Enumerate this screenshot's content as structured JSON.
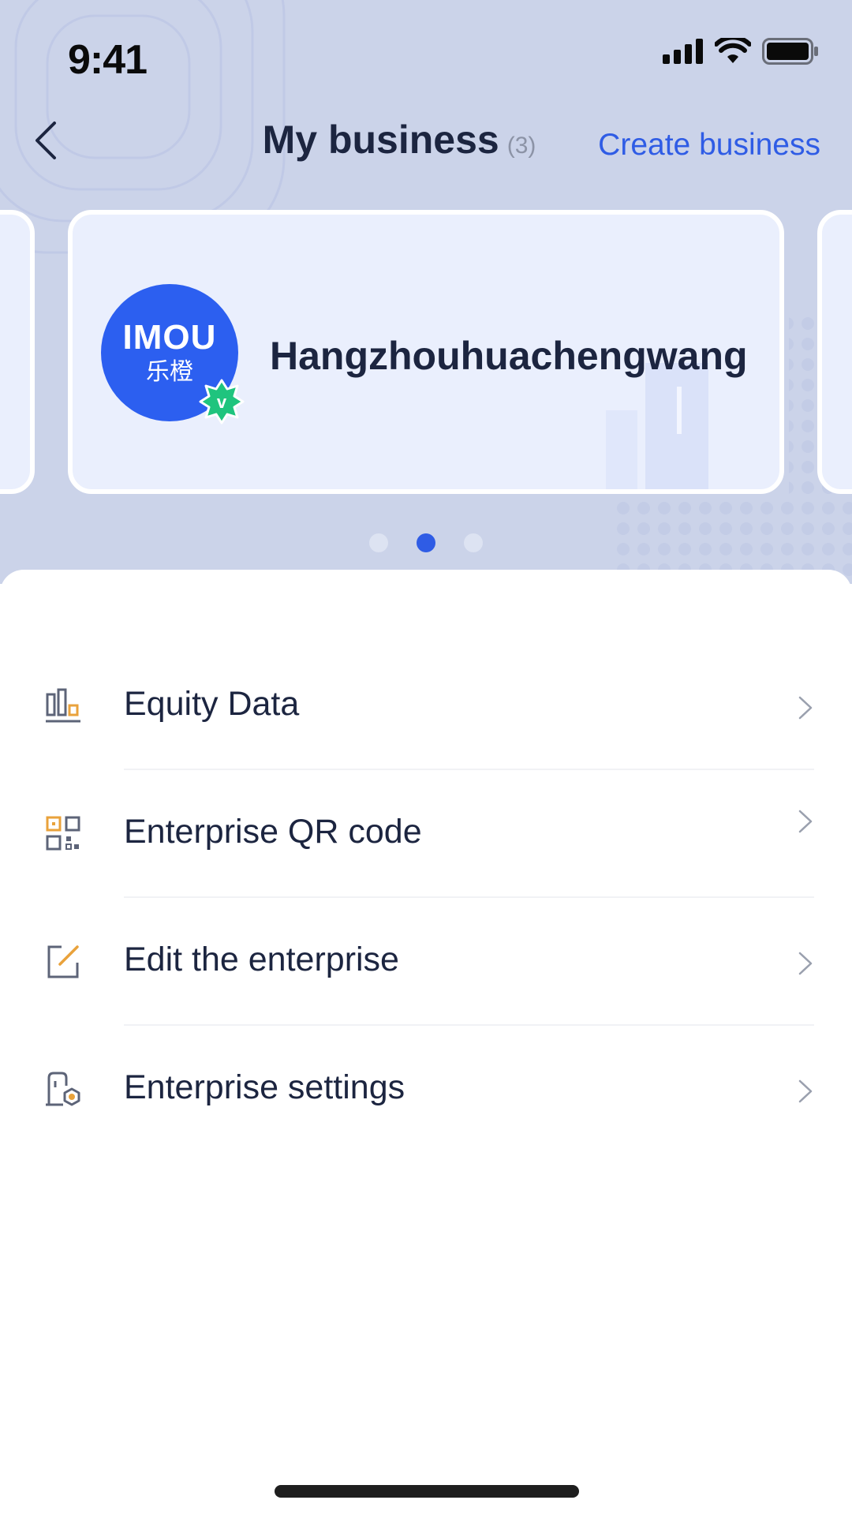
{
  "status_bar": {
    "time": "9:41"
  },
  "nav": {
    "title": "My business",
    "count": "(3)",
    "create_label": "Create business"
  },
  "carousel": {
    "business_name": "Hangzhouhuachengwang",
    "avatar_brand": "IMOU",
    "avatar_sub": "乐橙",
    "badge_letter": "v",
    "active_index": 2,
    "total": 3
  },
  "menu": {
    "items": [
      {
        "label": "Equity Data",
        "icon": "bar-chart-icon"
      },
      {
        "label": "Enterprise QR code",
        "icon": "qr-code-icon"
      },
      {
        "label": "Edit the enterprise",
        "icon": "edit-icon"
      },
      {
        "label": "Enterprise settings",
        "icon": "settings-icon"
      }
    ]
  },
  "colors": {
    "accent": "#2f5ce5",
    "header_bg": "#cbd3e9",
    "card_bg": "#eaeffd",
    "text_primary": "#1c2540",
    "icon_orange": "#e9a23b",
    "badge_green": "#1fc47e"
  }
}
